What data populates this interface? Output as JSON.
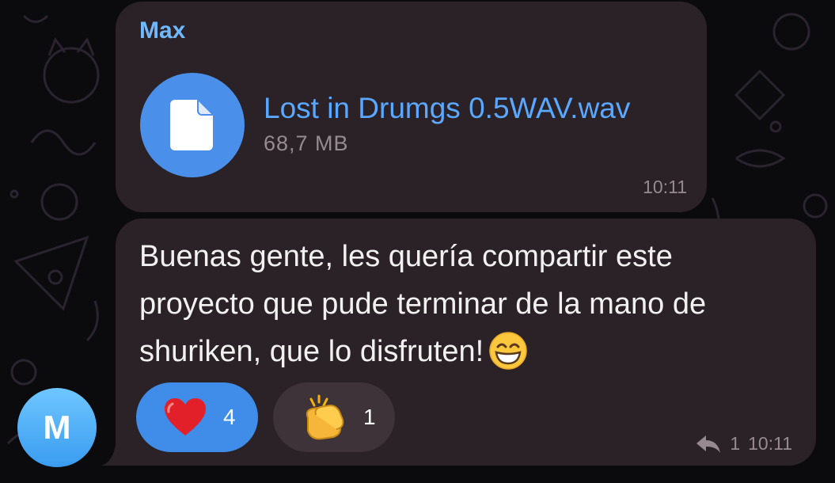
{
  "message_file": {
    "sender": "Max",
    "file_name": "Lost in Drumgs 0.5WAV.wav",
    "file_size": "68,7 MB",
    "time": "10:11",
    "icon": "document-icon"
  },
  "message_text": {
    "text": "Buenas gente, les quería compartir este proyecto que pude terminar de la mano de shuriken, que lo disfruten!",
    "emoji": "grinning-face-with-smiling-eyes",
    "reactions": [
      {
        "emoji": "red-heart",
        "count": "4",
        "selected": true
      },
      {
        "emoji": "clapping-hands",
        "count": "1",
        "selected": false
      }
    ],
    "reply_count": "1",
    "time": "10:11"
  },
  "avatar": {
    "initial": "M"
  },
  "colors": {
    "bubble": "#2b2227",
    "accent": "#4a90ea",
    "sender": "#70b9ff",
    "link": "#5aa8ff",
    "meta": "#948a90"
  }
}
